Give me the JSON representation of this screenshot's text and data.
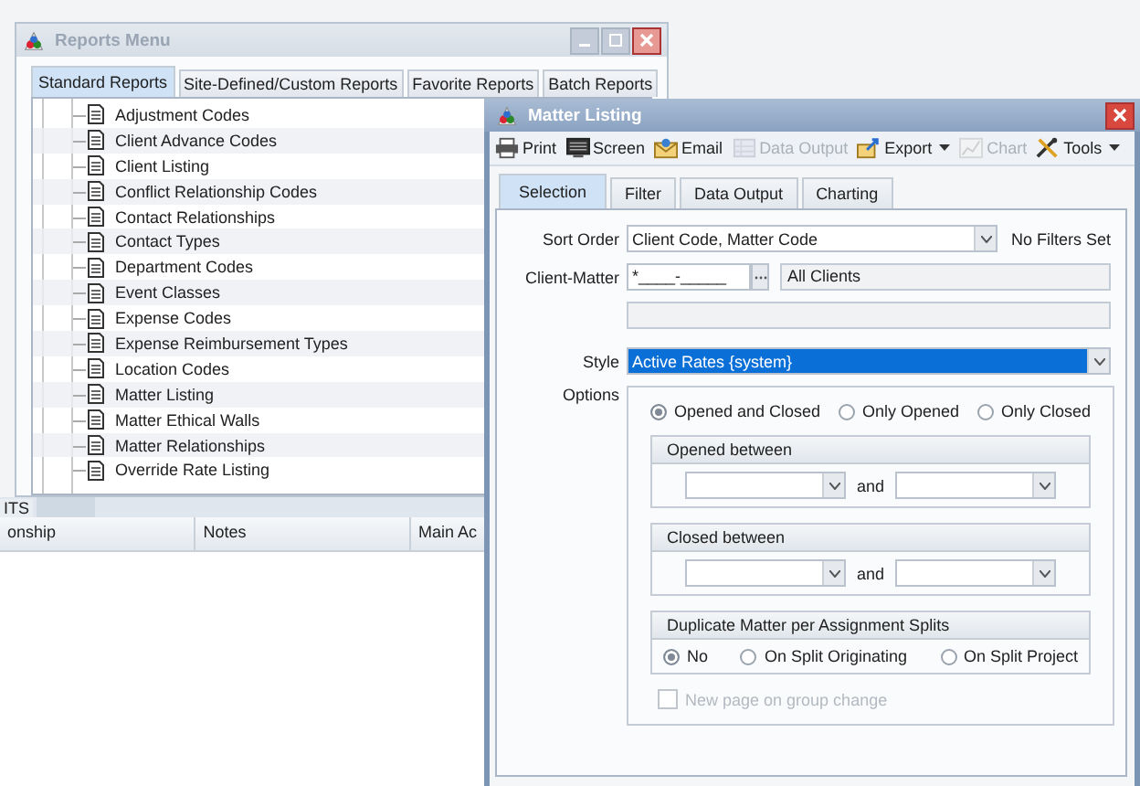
{
  "background_app": {
    "tabs": [
      {
        "label": "ITS"
      }
    ],
    "columns": [
      "onship",
      "Notes",
      "Main Ac"
    ]
  },
  "reports_window": {
    "title": "Reports Menu",
    "tabs": [
      {
        "label": "Standard Reports",
        "selected": true
      },
      {
        "label": "Site-Defined/Custom Reports",
        "selected": false
      },
      {
        "label": "Favorite Reports",
        "selected": false
      },
      {
        "label": "Batch Reports",
        "selected": false
      }
    ],
    "items": [
      "Adjustment Codes",
      "Client Advance Codes",
      "Client Listing",
      "Conflict Relationship Codes",
      "Contact Relationships",
      "Contact Types",
      "Department Codes",
      "Event Classes",
      "Expense Codes",
      "Expense Reimbursement Types",
      "Location Codes",
      "Matter Listing",
      "Matter Ethical Walls",
      "Matter Relationships",
      "Override Rate Listing"
    ]
  },
  "matter_window": {
    "title": "Matter Listing",
    "toolbar": [
      {
        "kind": "print",
        "label": "Print",
        "disabled": false,
        "menu": false
      },
      {
        "kind": "screen",
        "label": "Screen",
        "disabled": false,
        "menu": false
      },
      {
        "kind": "email",
        "label": "Email",
        "disabled": false,
        "menu": false
      },
      {
        "kind": "data",
        "label": "Data Output",
        "disabled": true,
        "menu": false
      },
      {
        "kind": "export",
        "label": "Export",
        "disabled": false,
        "menu": true
      },
      {
        "kind": "chart",
        "label": "Chart",
        "disabled": true,
        "menu": false
      },
      {
        "kind": "tools",
        "label": "Tools",
        "disabled": false,
        "menu": true
      }
    ],
    "tabs": [
      {
        "label": "Selection",
        "selected": true
      },
      {
        "label": "Filter",
        "selected": false
      },
      {
        "label": "Data Output",
        "selected": false
      },
      {
        "label": "Charting",
        "selected": false
      }
    ],
    "sort_order": {
      "label": "Sort Order",
      "value": "Client Code, Matter Code",
      "note": "No Filters Set"
    },
    "client_matter": {
      "label": "Client-Matter",
      "value": "*____-_____",
      "description": "All Clients"
    },
    "style": {
      "label": "Style",
      "value": "Active Rates {system}",
      "highlighted": true
    },
    "options": {
      "label": "Options",
      "status": [
        {
          "label": "Opened and Closed",
          "selected": true
        },
        {
          "label": "Only Opened",
          "selected": false
        },
        {
          "label": "Only Closed",
          "selected": false
        }
      ],
      "ranges": [
        {
          "title": "Opened between",
          "joiner": "and"
        },
        {
          "title": "Closed between",
          "joiner": "and"
        }
      ],
      "splits": {
        "title": "Duplicate Matter per Assignment Splits",
        "choices": [
          {
            "label": "No",
            "selected": true
          },
          {
            "label": "On Split Originating",
            "selected": false
          },
          {
            "label": "On Split Project",
            "selected": false
          }
        ]
      },
      "new_page": {
        "label": "New page on group change",
        "checked": false,
        "disabled": true
      }
    }
  }
}
